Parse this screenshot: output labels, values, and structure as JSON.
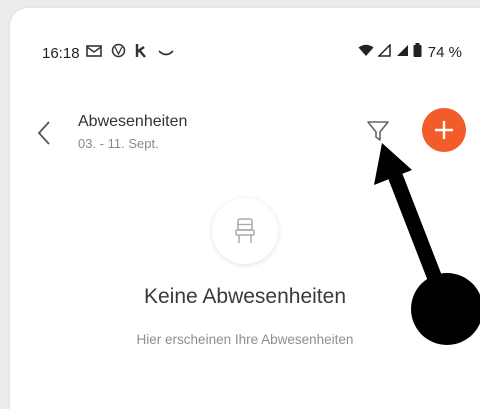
{
  "status_bar": {
    "time": "16:18",
    "icons": [
      "mail-icon",
      "vw-icon",
      "k-icon",
      "smile-icon"
    ],
    "battery_percent": "74 %"
  },
  "header": {
    "title": "Abwesenheiten",
    "date_range": "03. - 11. Sept."
  },
  "empty_state": {
    "icon": "chair-icon",
    "title": "Keine Abwesenheiten",
    "subtitle": "Hier erscheinen Ihre Abwesenheiten"
  },
  "colors": {
    "accent": "#f25c2a",
    "annotation": "#000000"
  }
}
